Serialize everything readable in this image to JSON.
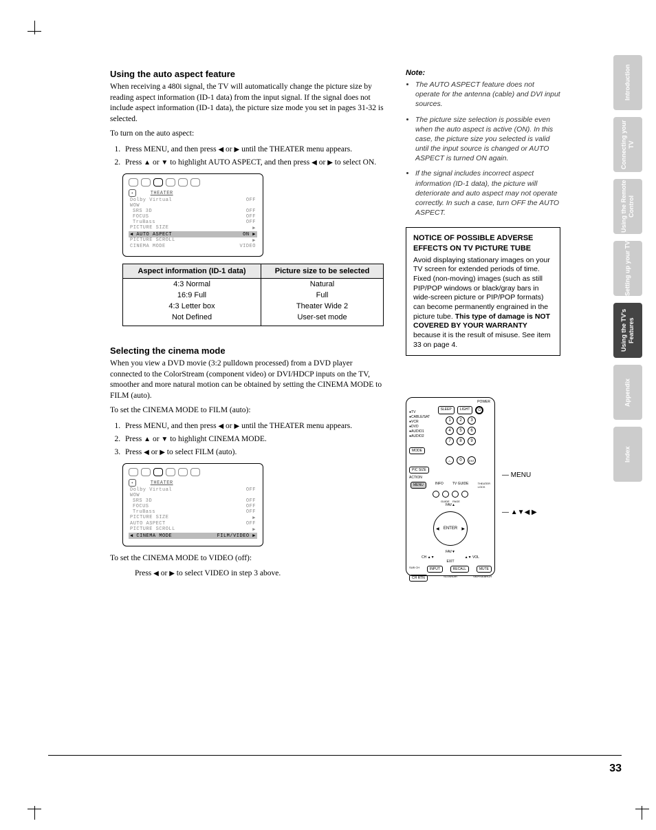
{
  "page_number": "33",
  "section1": {
    "heading": "Using the auto aspect feature",
    "p1": "When receiving a 480i signal, the TV will automatically change the picture size by reading aspect information (ID-1 data) from the input signal. If the signal does not include aspect information (ID-1 data), the picture size mode you set in pages 31-32 is selected.",
    "p2": "To turn on the auto aspect:",
    "step1a": "Press MENU, and then press ",
    "step1b": " or ",
    "step1c": " until the THEATER menu appears.",
    "step2a": "Press ",
    "step2b": " or ",
    "step2c": " to highlight AUTO ASPECT, and then press ",
    "step2d": " or ",
    "step2e": " to select ON.",
    "osd": {
      "title": "THEATER",
      "rows": [
        {
          "l": "Dolby Virtual",
          "r": "OFF"
        },
        {
          "l": "WOW",
          "r": ""
        },
        {
          "l": "SRS 3D",
          "r": "OFF",
          "indent": true
        },
        {
          "l": "FOCUS",
          "r": "OFF",
          "indent": true
        },
        {
          "l": "TruBass",
          "r": "OFF",
          "indent": true
        },
        {
          "l": "PICTURE SIZE",
          "r": "▶"
        },
        {
          "l": "AUTO ASPECT",
          "r": "ON",
          "hl": true,
          "arrow": true
        },
        {
          "l": "PICTURE SCROLL",
          "r": "▶"
        },
        {
          "l": "CINEMA MODE",
          "r": "VIDEO"
        }
      ]
    },
    "table": {
      "h1": "Aspect information (ID-1 data)",
      "h2": "Picture size to be selected",
      "rows": [
        {
          "a": "4:3 Normal",
          "b": "Natural"
        },
        {
          "a": "16:9 Full",
          "b": "Full"
        },
        {
          "a": "4:3 Letter box",
          "b": "Theater Wide 2"
        },
        {
          "a": "Not Defined",
          "b": "User-set mode"
        }
      ]
    }
  },
  "section2": {
    "heading": "Selecting the cinema mode",
    "p1": "When you view a DVD movie (3:2 pulldown processed) from a DVD player connected to the ColorStream (component video) or DVI/HDCP inputs on the TV, smoother and more natural motion can be obtained by setting the CINEMA MODE to FILM (auto).",
    "p2": "To set the CINEMA MODE to FILM (auto):",
    "step1a": "Press MENU, and then press ",
    "step1b": " or ",
    "step1c": " until the THEATER menu appears.",
    "step2a": "Press ",
    "step2b": " or ",
    "step2c": " to highlight CINEMA MODE.",
    "step3a": "Press ",
    "step3b": " or ",
    "step3c": " to select FILM (auto).",
    "osd": {
      "title": "THEATER",
      "rows": [
        {
          "l": "Dolby Virtual",
          "r": "OFF"
        },
        {
          "l": "WOW",
          "r": ""
        },
        {
          "l": "SRS 3D",
          "r": "OFF",
          "indent": true
        },
        {
          "l": "FOCUS",
          "r": "OFF",
          "indent": true
        },
        {
          "l": "TruBass",
          "r": "OFF",
          "indent": true
        },
        {
          "l": "PICTURE SIZE",
          "r": "▶"
        },
        {
          "l": "AUTO ASPECT",
          "r": "OFF"
        },
        {
          "l": "PICTURE SCROLL",
          "r": "▶"
        },
        {
          "l": "CINEMA MODE",
          "r": "FILM/VIDEO",
          "hl": true,
          "arrow": true
        }
      ]
    },
    "p3": "To set the CINEMA MODE to VIDEO (off):",
    "p4a": "Press ",
    "p4b": " or ",
    "p4c": " to select VIDEO in step 3 above."
  },
  "note": {
    "label": "Note:",
    "items": [
      "The AUTO ASPECT feature does not operate for the antenna (cable) and DVI input sources.",
      "The picture size selection is possible even when the auto aspect is active (ON). In this case, the picture size you selected is valid until the input source is changed or AUTO ASPECT is turned ON again.",
      "If the signal includes incorrect aspect information (ID-1 data), the picture will deteriorate and auto aspect may not operate correctly. In such a case, turn OFF the AUTO ASPECT."
    ]
  },
  "notice": {
    "title": "NOTICE OF POSSIBLE ADVERSE EFFECTS ON TV PICTURE TUBE",
    "body_a": "Avoid displaying stationary images on your TV screen for extended periods of time. Fixed (non-moving) images (such as still PIP/POP windows or black/gray bars in wide-screen picture or PIP/POP formats) can become permanently engrained in the picture tube. ",
    "body_b": "This type of damage is NOT COVERED BY YOUR WARRANTY",
    "body_c": " because it is the result of misuse. See item 33 on page 4."
  },
  "remote": {
    "menu_label": "MENU",
    "arrows_label": "▲▼◀ ▶",
    "power": "POWER",
    "sleep": "SLEEP",
    "light": "LIGHT",
    "tv": "TV",
    "cablesat": "CABLE/SAT",
    "dvd": "DVD",
    "vcr": "VCR",
    "audio1": "AUDIO1",
    "audio2": "AUDIO2",
    "mode": "MODE",
    "pic_size": "PIC SIZE",
    "action": "ACTION",
    "menu": "MENU",
    "info": "INFO",
    "tv_guide": "TV GUIDE",
    "theater_lock": "THEATER LOCK",
    "guide": "GUIDE",
    "page": "PAGE",
    "fav": "FAV",
    "enter": "ENTER",
    "ch": "CH",
    "vol": "VOL",
    "exit": "EXIT",
    "input": "INPUT",
    "recall": "RECALL",
    "mute": "MUTE",
    "subch": "SUB CH",
    "chrtn": "CH RTN",
    "slow": "SLOW/DIR",
    "skip": "SKIP/SEARCH",
    "ent": "ENT"
  },
  "tabs": {
    "t1": "Introduction",
    "t2": "Connecting your TV",
    "t3": "Using the Remote Control",
    "t4": "Setting up your TV",
    "t5": "Using the TV's Features",
    "t6": "Appendix",
    "t7": "Index"
  }
}
